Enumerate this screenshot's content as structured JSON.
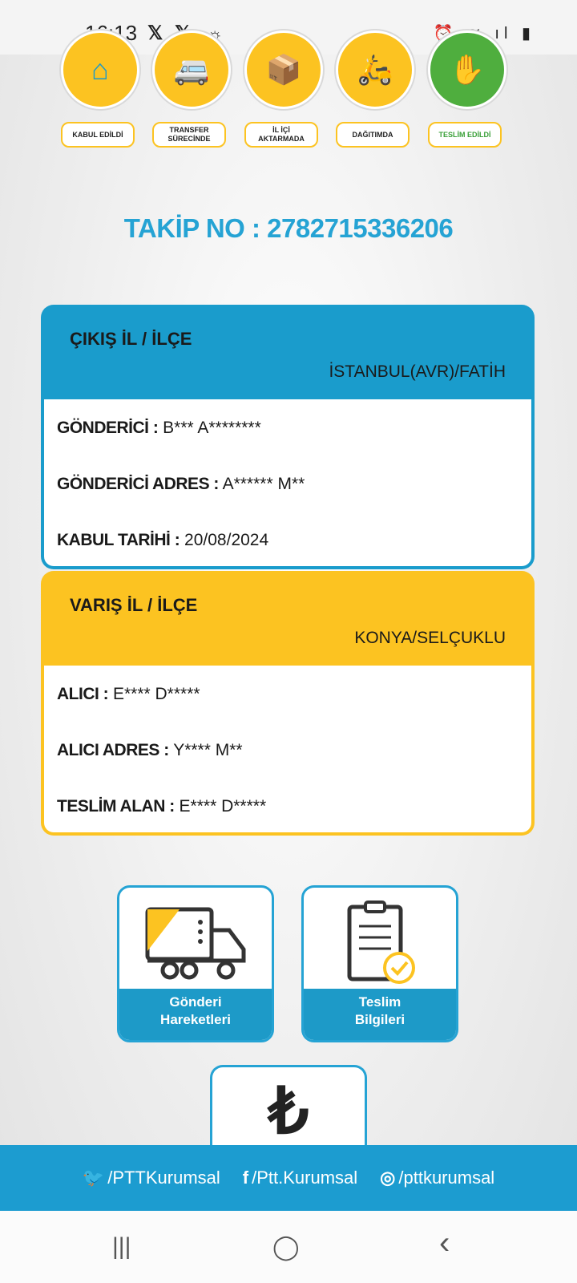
{
  "status": {
    "time": "16:13",
    "x1": "𝕏",
    "x2": "𝕏",
    "sun": "☼",
    "right": "⏰ ≋ ıl ▮"
  },
  "steps": [
    {
      "label": "KABUL EDİLDİ",
      "icon": "house-icon"
    },
    {
      "label": "TRANSFER SÜRECİNDE",
      "icon": "van-icon"
    },
    {
      "label": "İL İÇİ AKTARMADA",
      "icon": "courier-icon"
    },
    {
      "label": "DAĞITIMDA",
      "icon": "scooter-icon"
    },
    {
      "label": "TESLİM EDİLDİ",
      "icon": "delivered-icon"
    }
  ],
  "tracking": {
    "label": "TAKİP NO : 2782715336206"
  },
  "origin": {
    "title": "ÇIKIŞ İL / İLÇE",
    "place": "İSTANBUL(AVR)/FATİH",
    "sender_label": "GÖNDERİCİ :",
    "sender_value": " B*** A********",
    "address_label": "GÖNDERİCİ ADRES :",
    "address_value": " A****** M**",
    "date_label": "KABUL TARİHİ :",
    "date_value": " 20/08/2024"
  },
  "destination": {
    "title": "VARIŞ İL / İLÇE",
    "place": "KONYA/SELÇUKLU",
    "receiver_label": "ALICI :",
    "receiver_value": " E**** D*****",
    "address_label": "ALICI ADRES :",
    "address_value": " Y**** M**",
    "recipient_label": "TESLİM ALAN :",
    "recipient_value": " E**** D*****"
  },
  "tiles": {
    "movements_line1": "Gönderi",
    "movements_line2": "Hareketleri",
    "delivery_line1": "Teslim",
    "delivery_line2": "Bilgileri",
    "lira_symbol": "₺"
  },
  "footer": {
    "twitter": "/PTTKurumsal",
    "facebook": "/Ptt.Kurumsal",
    "instagram": "/pttkurumsal"
  },
  "nav": {
    "recents": "|||",
    "home": "◯",
    "back": "‹"
  },
  "colors": {
    "brand_blue": "#1a9ccc",
    "brand_yellow": "#fcc321",
    "delivered_green": "#4fae3e"
  }
}
